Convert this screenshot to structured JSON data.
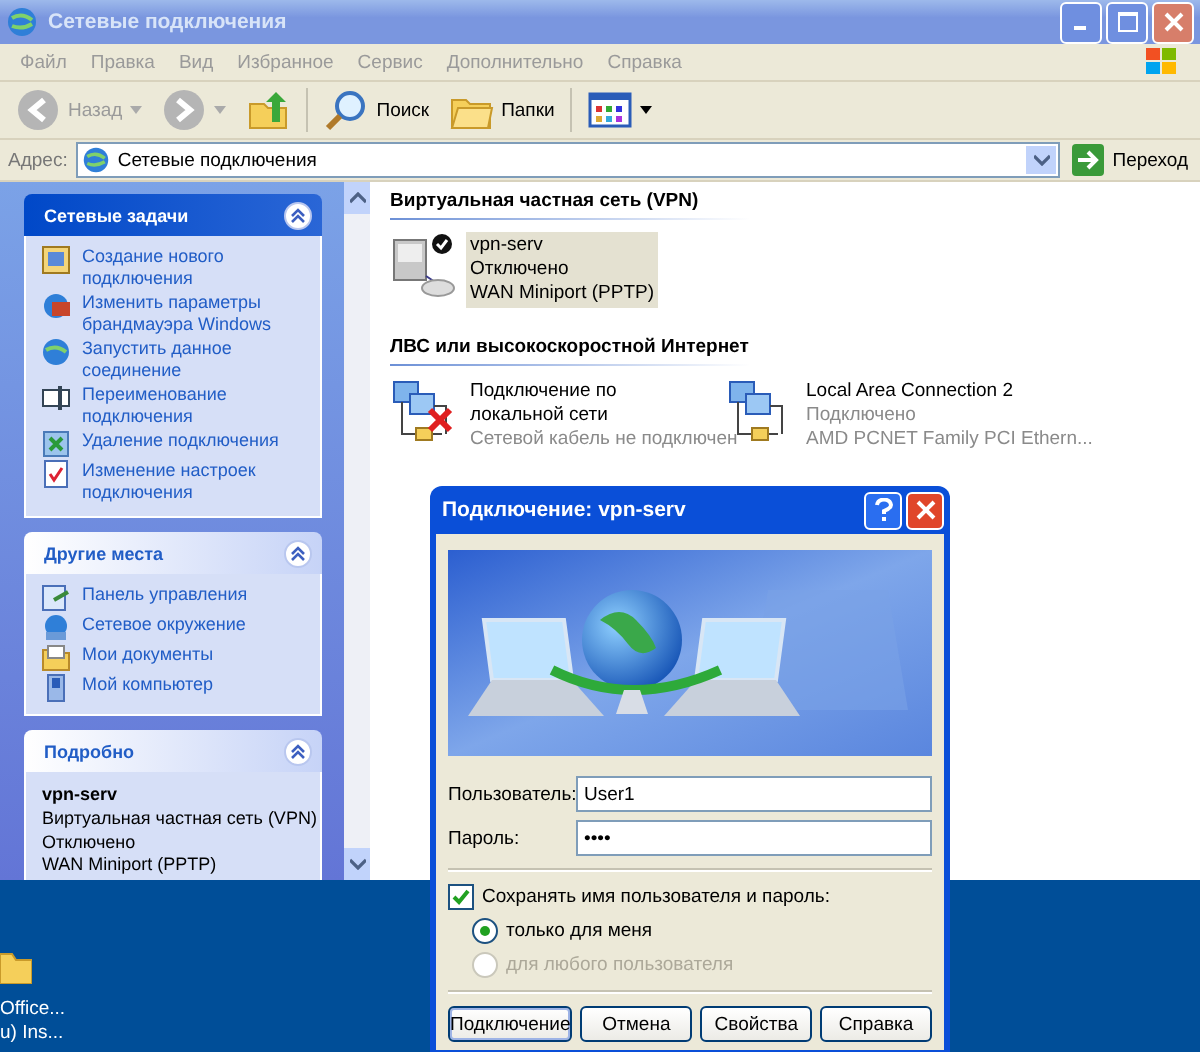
{
  "window": {
    "title": "Сетевые подключения",
    "active": false
  },
  "menu": [
    "Файл",
    "Правка",
    "Вид",
    "Избранное",
    "Сервис",
    "Дополнительно",
    "Справка"
  ],
  "toolbar": [
    {
      "kind": "back",
      "label": "Назад",
      "disabled": true
    },
    {
      "kind": "forward",
      "disabled": true
    },
    {
      "kind": "up",
      "disabled": false
    },
    {
      "kind": "search",
      "label": "Поиск",
      "disabled": false
    },
    {
      "kind": "folders",
      "label": "Папки",
      "disabled": false
    },
    {
      "kind": "views",
      "disabled": false
    }
  ],
  "address": {
    "label": "Адрес:",
    "value": "Сетевые подключения",
    "go": "Переход"
  },
  "sidebar": {
    "panels": [
      {
        "title": "Сетевые задачи",
        "kind": "special",
        "items": [
          "Создание нового подключения",
          "Изменить параметры брандмауэра Windows",
          "Запустить данное соединение",
          "Переименование подключения",
          "Удаление подключения",
          "Изменение настроек подключения"
        ]
      },
      {
        "title": "Другие места",
        "kind": "normal",
        "items": [
          "Панель управления",
          "Сетевое окружение",
          "Мои документы",
          "Мой компьютер"
        ]
      },
      {
        "title": "Подробно",
        "kind": "details",
        "name": "vpn-serv",
        "lines": [
          "Виртуальная частная сеть (VPN)",
          "Отключено",
          "WAN Miniport (PPTP)"
        ]
      }
    ]
  },
  "groups": [
    {
      "title": "Виртуальная частная сеть (VPN)",
      "connections": [
        {
          "kind": "vpn",
          "name": "vpn-serv",
          "status": "Отключено",
          "device": "WAN Miniport (PPTP)",
          "selected": true,
          "unplugged": false
        }
      ]
    },
    {
      "title": "ЛВС или высокоскоростной Интернет",
      "connections": [
        {
          "kind": "lan",
          "name": "Подключение по локальной сети",
          "status": "Сетевой кабель не подключен",
          "selected": false,
          "unplugged": true
        },
        {
          "kind": "lan",
          "name": "Local Area Connection 2",
          "status": "Подключено",
          "device": "AMD PCNET Family PCI Ethern...",
          "selected": false,
          "unplugged": false
        }
      ]
    }
  ],
  "desktop": {
    "icon_label": [
      "Office...",
      "u) Ins..."
    ]
  },
  "dialog": {
    "title": "Подключение: vpn-serv",
    "fields": [
      {
        "label": "Пользователь:",
        "value": "User1"
      },
      {
        "label": "Пароль:",
        "value": "••••"
      }
    ],
    "save": {
      "label": "Сохранять имя пользователя и пароль:",
      "checked": true
    },
    "radios": [
      {
        "label": "только для меня",
        "selected": true,
        "disabled": false
      },
      {
        "label": "для любого пользователя",
        "selected": false,
        "disabled": true
      }
    ],
    "buttons": [
      {
        "label": "Подключение",
        "default": true
      },
      {
        "label": "Отмена",
        "default": false
      },
      {
        "label": "Свойства",
        "default": false
      },
      {
        "label": "Справка",
        "default": false
      }
    ]
  }
}
